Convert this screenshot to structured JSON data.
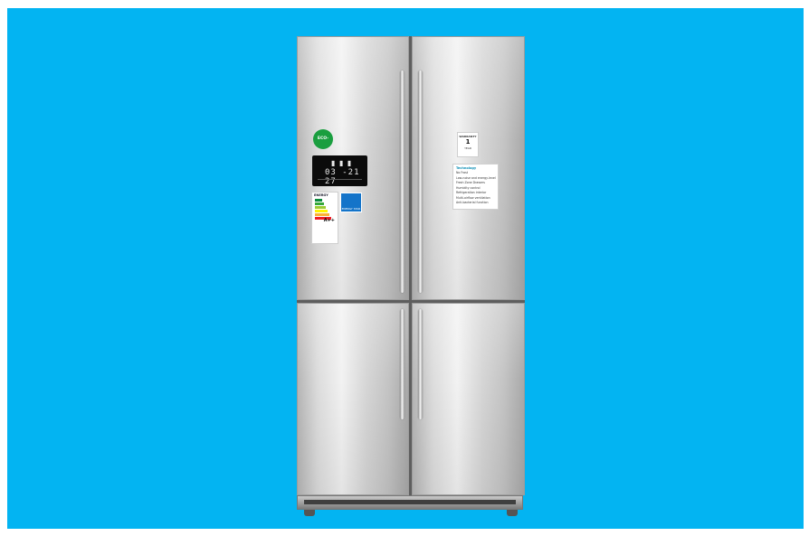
{
  "scene": {
    "background_color": "#03b4f2",
    "subject": "stainless steel french-door refrigerator",
    "subject_color": "#d9d9d9"
  },
  "labels": {
    "eco_badge": "ECO-WAY",
    "display_readout": "03 -21 27",
    "energy_brand": "ENERGY",
    "energy_class": "A++",
    "energy_star_label": "ENERGY STAR",
    "warranty_title": "WARRANTY",
    "warranty_years": "1",
    "warranty_unit": "YEAR",
    "features_title": "Technology",
    "features": [
      "No Frost",
      "Low-noise and energy-level",
      "Fresh Zone Drawers",
      "Humidity control",
      "Refrigeration interior",
      "Multi-airflow ventilation",
      "Anti-bacterial function"
    ]
  }
}
